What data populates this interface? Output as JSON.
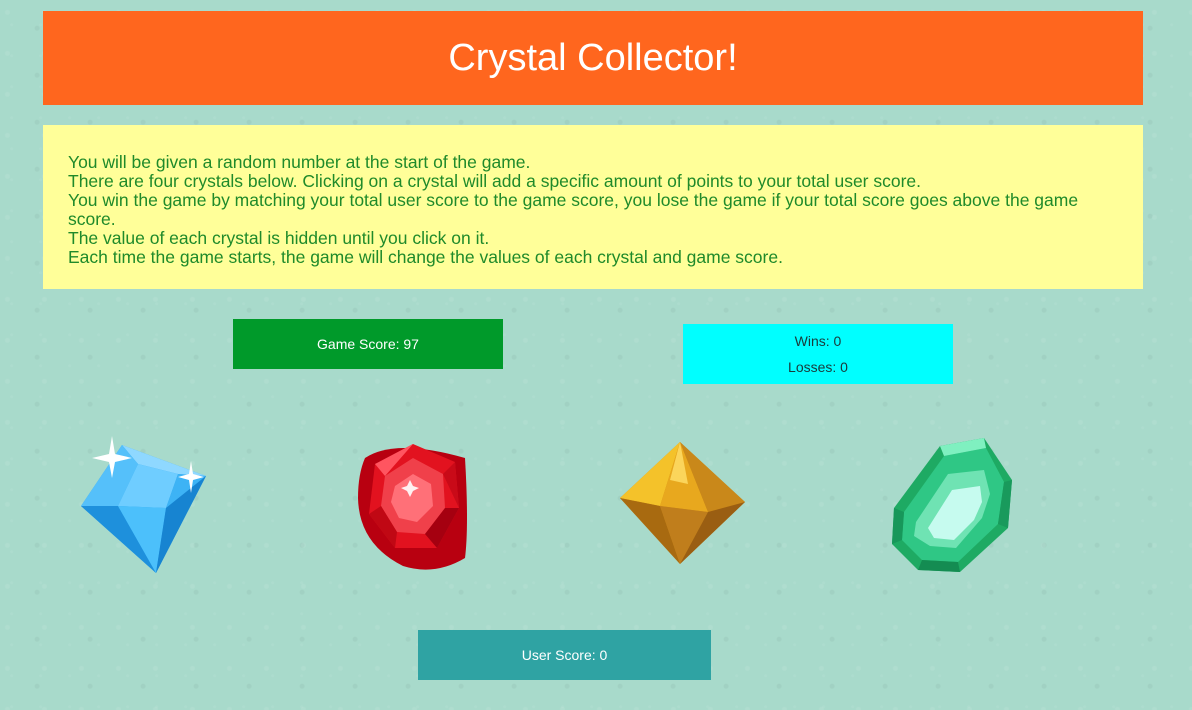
{
  "header": {
    "title": "Crystal Collector!"
  },
  "instructions": [
    "You will be given a random number at the start of the game.",
    "There are four crystals below. Clicking on a crystal will add a specific amount of points to your total user score.",
    "You win the game by matching your total user score to the game score, you lose the game if your total score goes above the game score.",
    "The value of each crystal is hidden until you click on it.",
    "Each time the game starts, the game will change the values of each crystal and game score."
  ],
  "game_score": {
    "text": "Game Score: 97"
  },
  "record": {
    "wins": "Wins: 0",
    "losses": "Losses: 0"
  },
  "user_score": {
    "text": "User Score: 0"
  },
  "crystals": [
    {
      "icon": "blue-diamond-crystal-icon",
      "color": "#3fb3f5"
    },
    {
      "icon": "red-ruby-crystal-icon",
      "color": "#e0121f"
    },
    {
      "icon": "gold-octahedron-crystal-icon",
      "color": "#f0b020"
    },
    {
      "icon": "green-emerald-crystal-icon",
      "color": "#2fc785"
    }
  ],
  "colors": {
    "header_bg": "#ff661e",
    "instructions_bg": "#ffff99",
    "instructions_text": "#1f8a2a",
    "game_score_bg": "#009a2a",
    "record_bg": "#00ffff",
    "user_score_bg": "#2fa3a3",
    "page_bg": "#a8dacb"
  }
}
